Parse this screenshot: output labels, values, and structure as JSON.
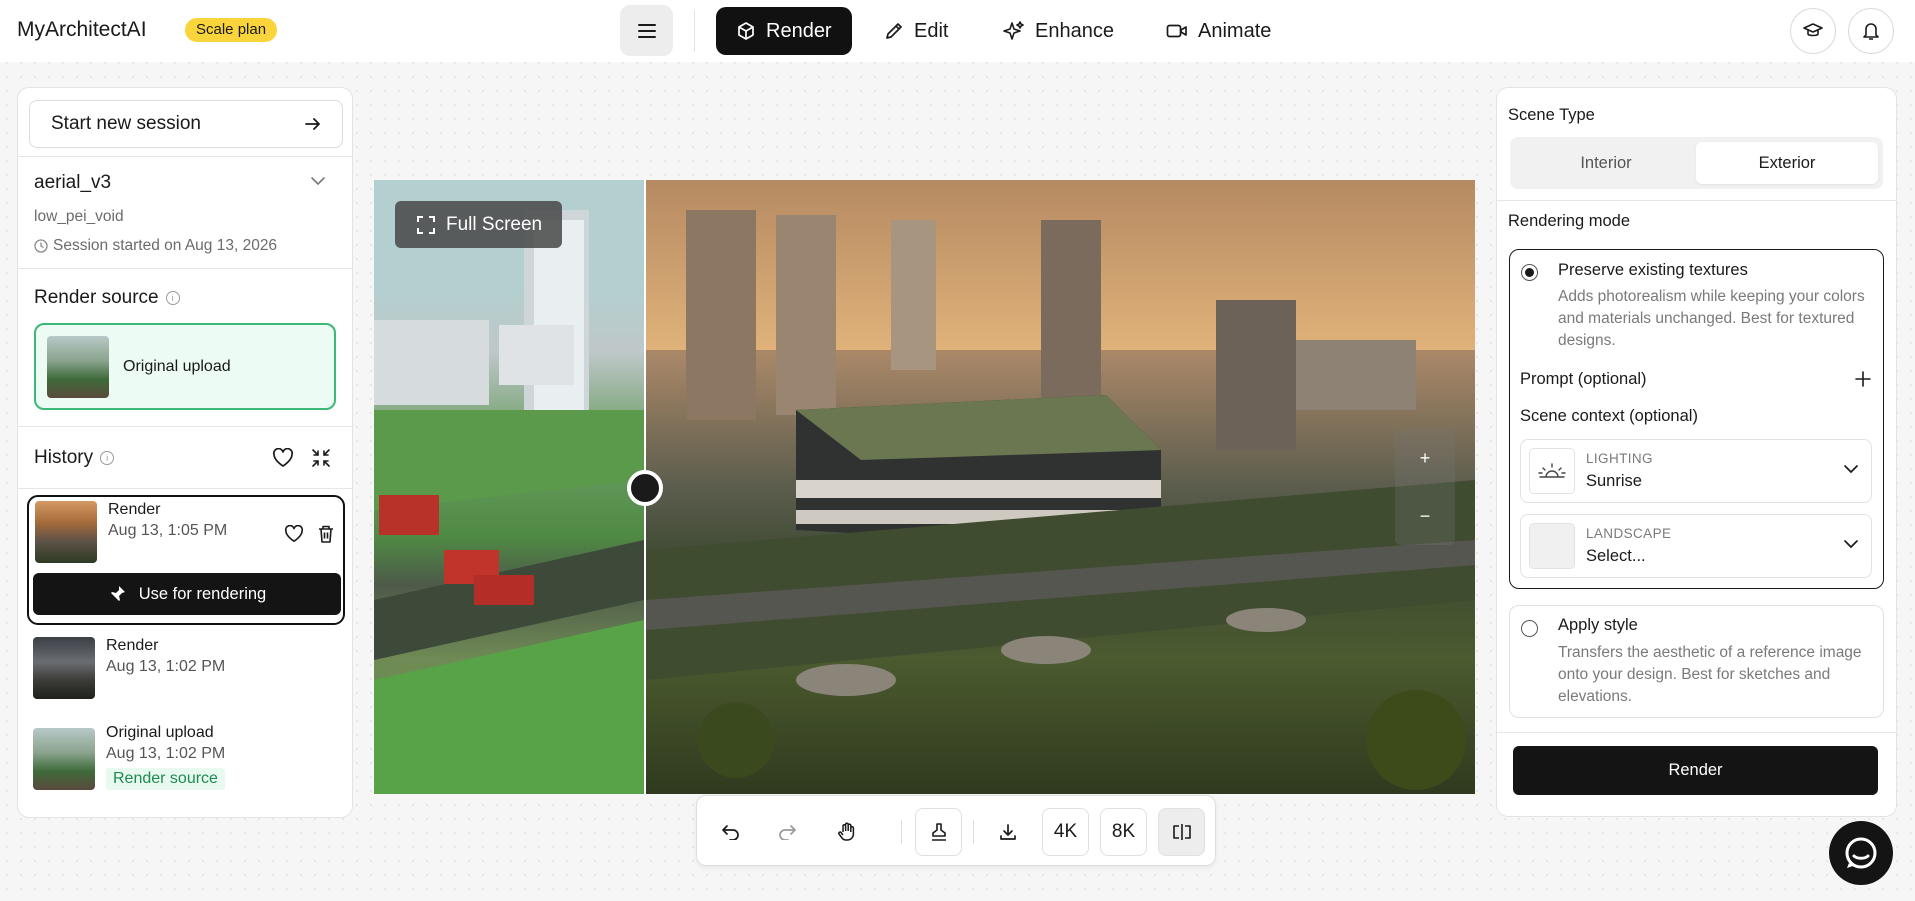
{
  "app": {
    "name": "MyArchitectAI",
    "plan_badge": "Scale plan"
  },
  "header": {
    "tabs": [
      {
        "label": "Render",
        "icon": "cube-icon",
        "active": true
      },
      {
        "label": "Edit",
        "icon": "pencil-icon",
        "active": false
      },
      {
        "label": "Enhance",
        "icon": "sparkle-icon",
        "active": false
      },
      {
        "label": "Animate",
        "icon": "video-icon",
        "active": false
      }
    ]
  },
  "sidebar": {
    "new_session": "Start new session",
    "session": {
      "name": "aerial_v3",
      "subtitle": "low_pei_void",
      "started": "Session started on Aug 13, 2026"
    },
    "render_source": {
      "title": "Render source",
      "card_label": "Original upload"
    },
    "history": {
      "title": "History",
      "items": [
        {
          "title": "Render",
          "date": "Aug 13, 1:05 PM",
          "selected": true,
          "action": "Use for rendering"
        },
        {
          "title": "Render",
          "date": "Aug 13, 1:02 PM",
          "selected": false
        },
        {
          "title": "Original upload",
          "date": "Aug 13, 1:02 PM",
          "selected": false,
          "tag": "Render source"
        }
      ]
    }
  },
  "canvas": {
    "fullscreen_label": "Full Screen",
    "zoom_in": "+",
    "zoom_out": "−"
  },
  "toolbar": {
    "buttons": [
      "undo-icon",
      "redo-icon",
      "hand-icon",
      "stamp-icon",
      "download-icon",
      "4K",
      "8K",
      "compare-icon"
    ],
    "res_4k": "4K",
    "res_8k": "8K"
  },
  "settings": {
    "scene_type_label": "Scene Type",
    "scene_types": [
      "Interior",
      "Exterior"
    ],
    "scene_type_selected": "Exterior",
    "rendering_mode_label": "Rendering mode",
    "modes": [
      {
        "title": "Preserve existing textures",
        "description": "Adds photorealism while keeping your colors and materials unchanged. Best for textured designs.",
        "selected": true
      },
      {
        "title": "Apply style",
        "description": "Transfers the aesthetic of a reference image onto your design. Best for sketches and elevations.",
        "selected": false
      }
    ],
    "prompt_label": "Prompt (optional)",
    "scene_context_label": "Scene context (optional)",
    "lighting": {
      "caption": "LIGHTING",
      "value": "Sunrise"
    },
    "landscape": {
      "caption": "LANDSCAPE",
      "value": "Select..."
    },
    "render_button": "Render"
  },
  "colors": {
    "accent_dark": "#141414",
    "plan_badge": "#f9d43a",
    "source_green": "#3cb877"
  }
}
